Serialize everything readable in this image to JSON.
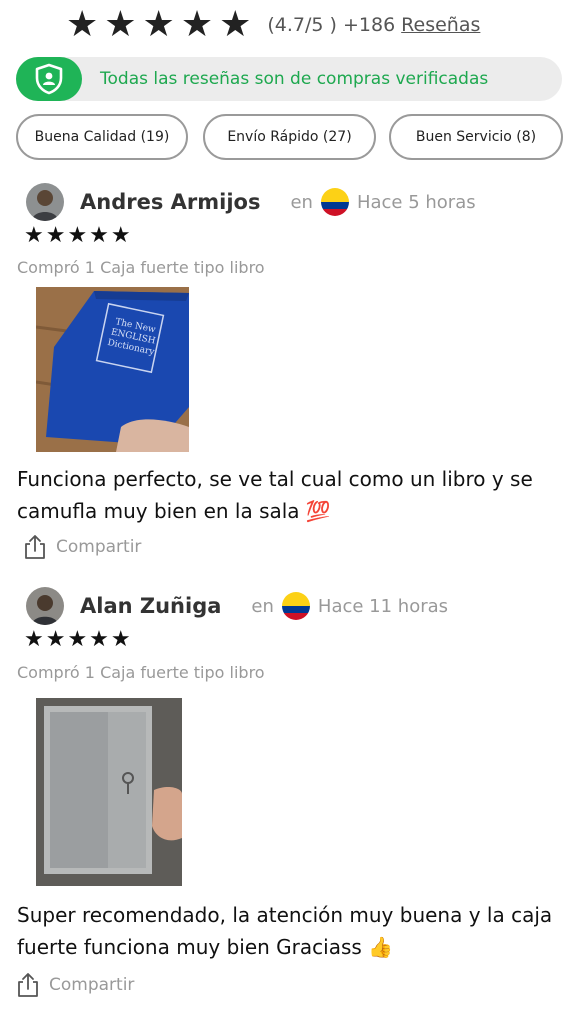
{
  "summary": {
    "stars": "★★★★★",
    "rating_text": "(4.7/5 ) +186",
    "reviews_link": "Reseñas",
    "verified_text": "Todas las reseñas son de compras verificadas"
  },
  "filters": [
    {
      "label": "Buena Calidad (19)"
    },
    {
      "label": "Envío Rápido (27)"
    },
    {
      "label": "Buen Servicio (8)"
    }
  ],
  "reviews": [
    {
      "name": "Andres Armijos",
      "country_prefix": "en",
      "time": "Hace 5 horas",
      "stars": "★★★★★",
      "purchase": "Compró 1 Caja fuerte tipo libro",
      "book_text": "The New ENGLISH Dictionary",
      "comment": "Funciona perfecto, se ve tal cual como un libro y se camufla muy bien en la sala 💯",
      "share": "Compartir"
    },
    {
      "name": "Alan Zuñiga",
      "country_prefix": "en",
      "time": "Hace 11 horas",
      "stars": "★★★★★",
      "purchase": "Compró 1 Caja fuerte tipo libro",
      "comment": "Super recomendado, la atención muy buena y la caja fuerte funciona muy bien Graciass 👍",
      "share": "Compartir"
    }
  ],
  "colors": {
    "verified_green": "#1fb457",
    "flag_yellow": "#fcd116",
    "flag_blue": "#003893",
    "flag_red": "#ce1126"
  }
}
